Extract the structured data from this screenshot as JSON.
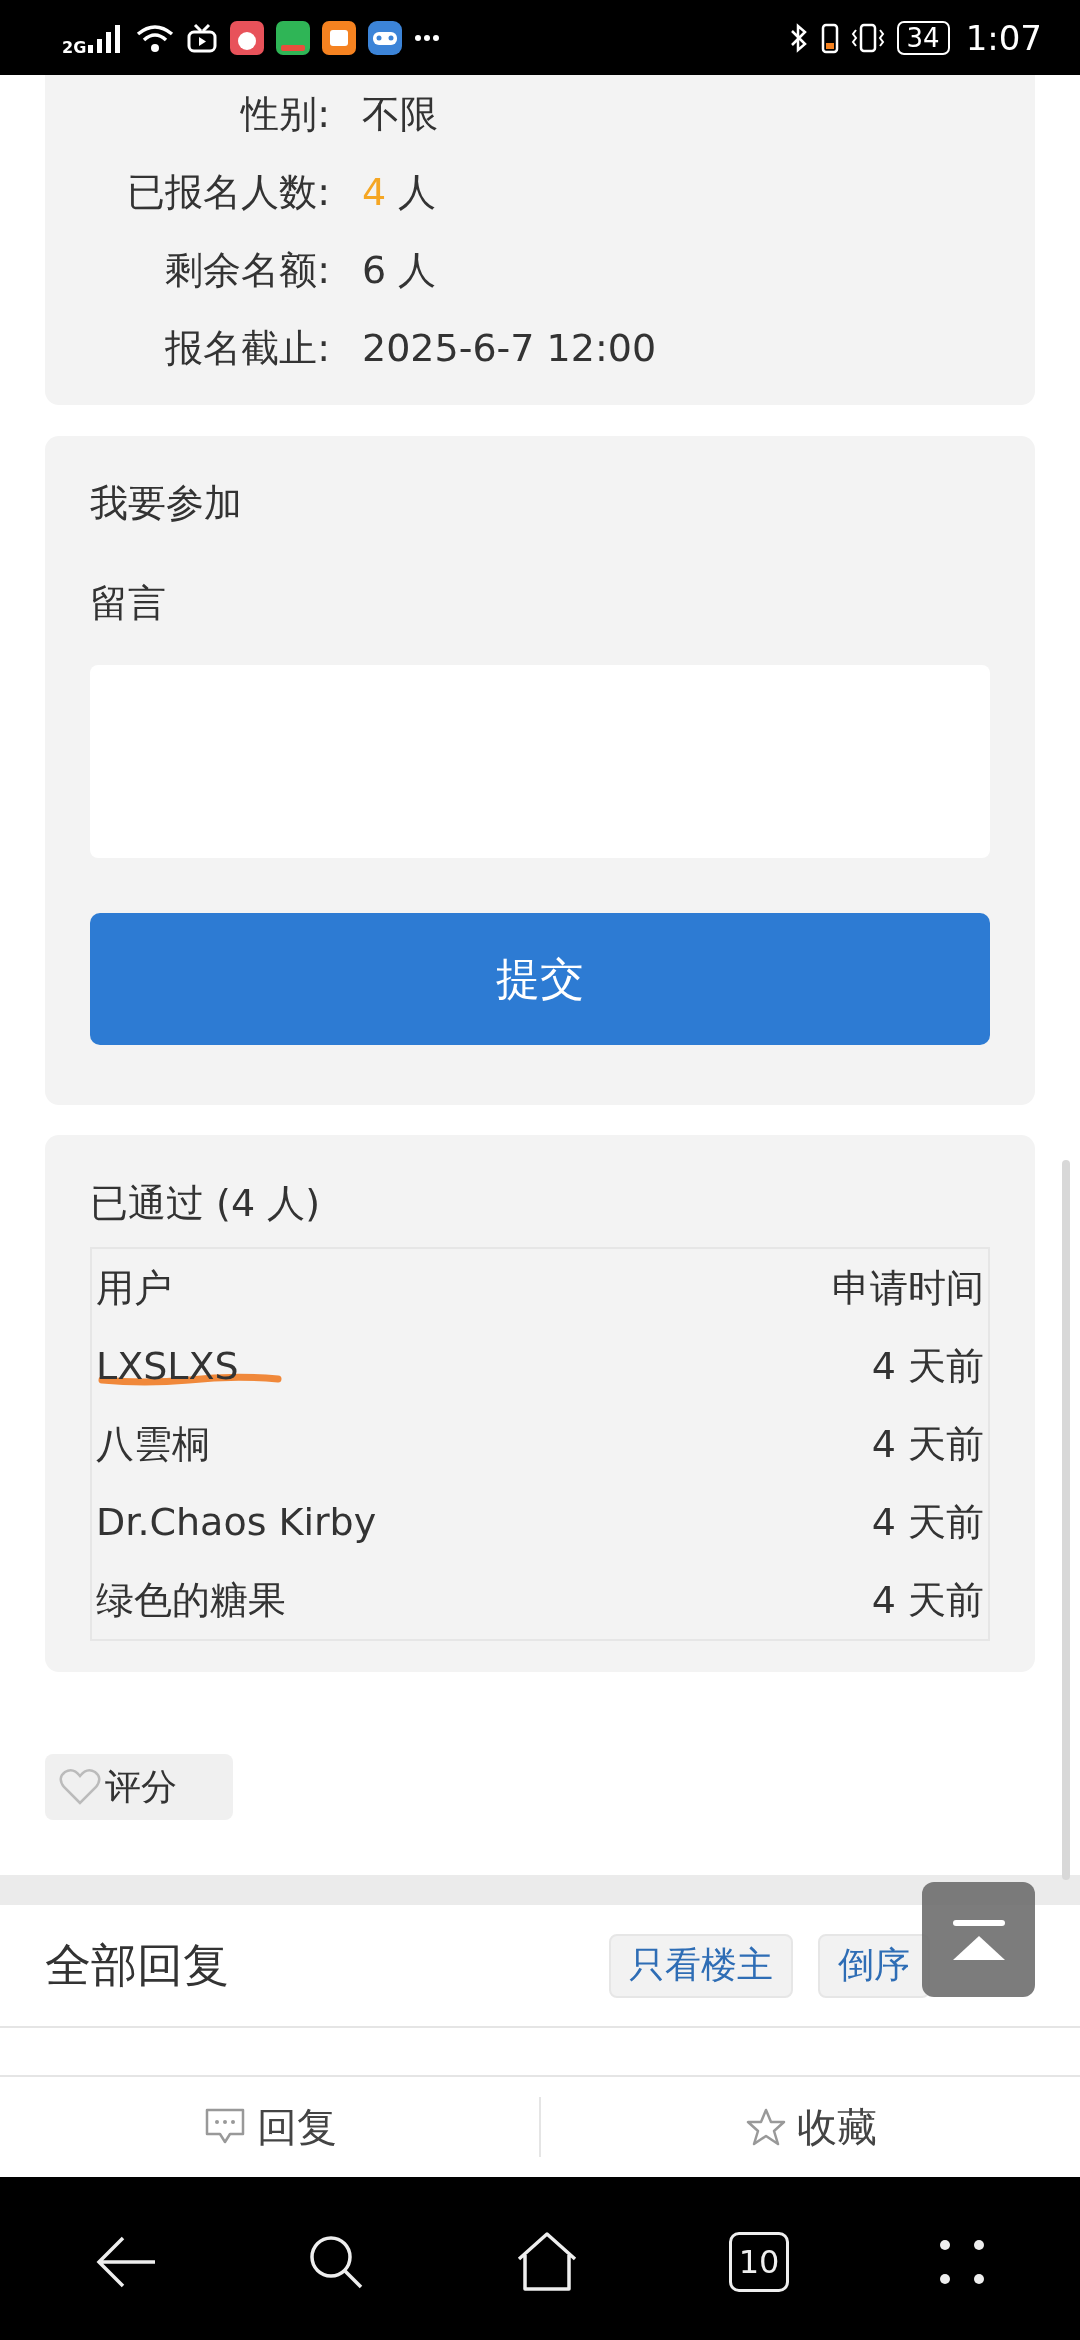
{
  "status_bar": {
    "network": "2G",
    "battery": "34",
    "time": "1:07"
  },
  "details": [
    {
      "label": "性别:",
      "value": "不限",
      "highlight": false
    },
    {
      "label": "已报名人数:",
      "value": "4",
      "unit": "人",
      "highlight": true
    },
    {
      "label": "剩余名额:",
      "value": "6",
      "unit": "人",
      "highlight": false
    },
    {
      "label": "报名截止:",
      "value": "2025-6-7 12:00",
      "highlight": false
    }
  ],
  "join": {
    "title": "我要参加",
    "message_label": "留言",
    "submit": "提交"
  },
  "approved": {
    "title": "已通过 (4 人)",
    "columns": [
      "用户",
      "申请时间"
    ],
    "rows": [
      {
        "user": "LXSLXS",
        "time": "4 天前",
        "marked": true
      },
      {
        "user": "八雲桐",
        "time": "4 天前",
        "marked": false
      },
      {
        "user": "Dr.Chaos Kirby",
        "time": "4 天前",
        "marked": false
      },
      {
        "user": "绿色的糖果",
        "time": "4 天前",
        "marked": false
      }
    ]
  },
  "rate_button": "评分",
  "replies": {
    "title": "全部回复",
    "filters": [
      "只看楼主",
      "倒序"
    ]
  },
  "actions": [
    {
      "kind": "reply",
      "label": "回复"
    },
    {
      "kind": "favorite",
      "label": "收藏"
    }
  ],
  "nav": {
    "tabs_count": "10"
  }
}
